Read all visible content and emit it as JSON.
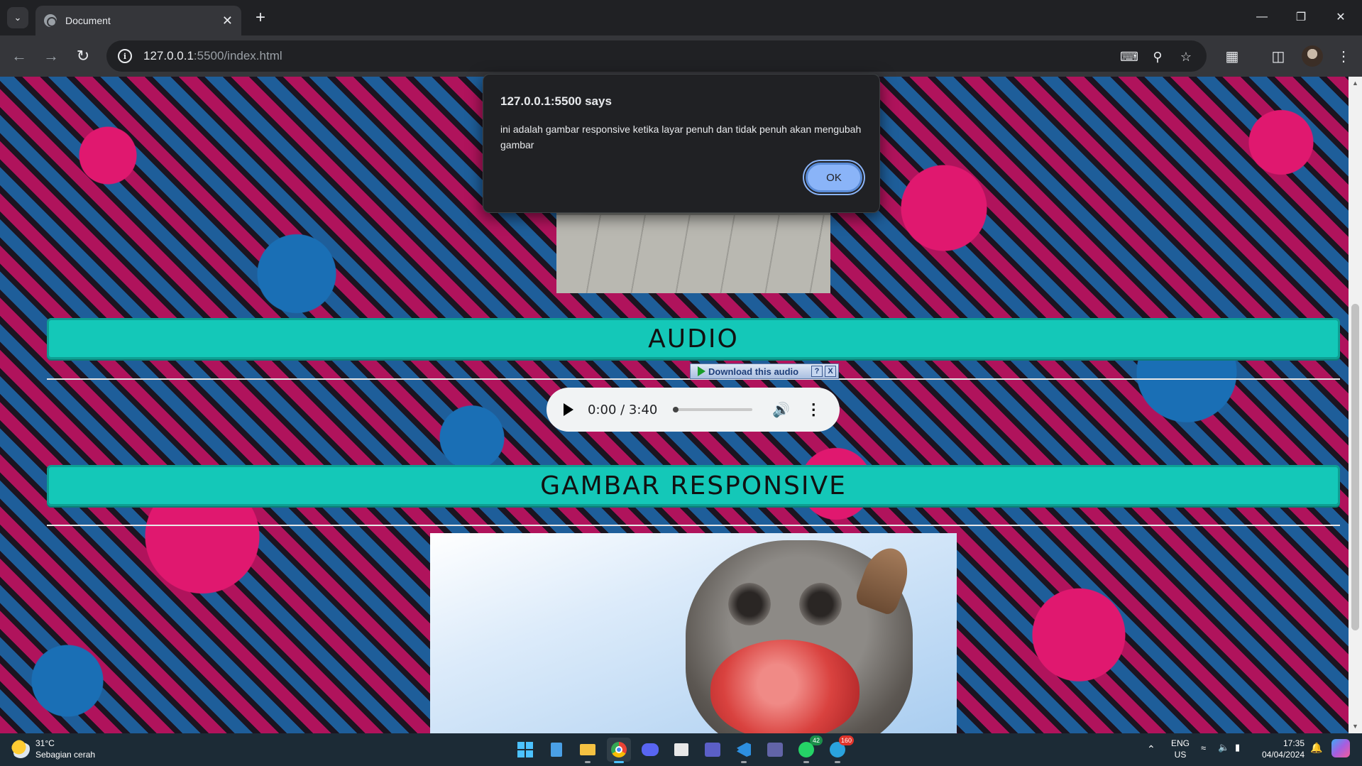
{
  "browser": {
    "tab_title": "Document",
    "url_host": "127.0.0.1",
    "url_rest": ":5500/index.html"
  },
  "dialog": {
    "title": "127.0.0.1:5500 says",
    "message": "ini adalah gambar responsive ketika layar penuh dan tidak penuh akan mengubah gambar",
    "ok_label": "OK"
  },
  "page": {
    "audio_heading": "AUDIO",
    "image_heading": "GAMBAR RESPONSIVE",
    "download_badge": "Download this audio",
    "download_help": "?",
    "download_close": "X",
    "audio_time": "0:00 / 3:40",
    "audio_progress": 0
  },
  "taskbar": {
    "temperature": "31°C",
    "weather_desc": "Sebagian cerah",
    "lang": "ENG",
    "region": "US",
    "time": "17:35",
    "date": "04/04/2024",
    "whatsapp_badge": "42",
    "telegram_badge": "160"
  },
  "colors": {
    "section_bar": "#14c8b8",
    "dialog_button": "#8ab4f8",
    "taskbar": "#1c2b36"
  }
}
